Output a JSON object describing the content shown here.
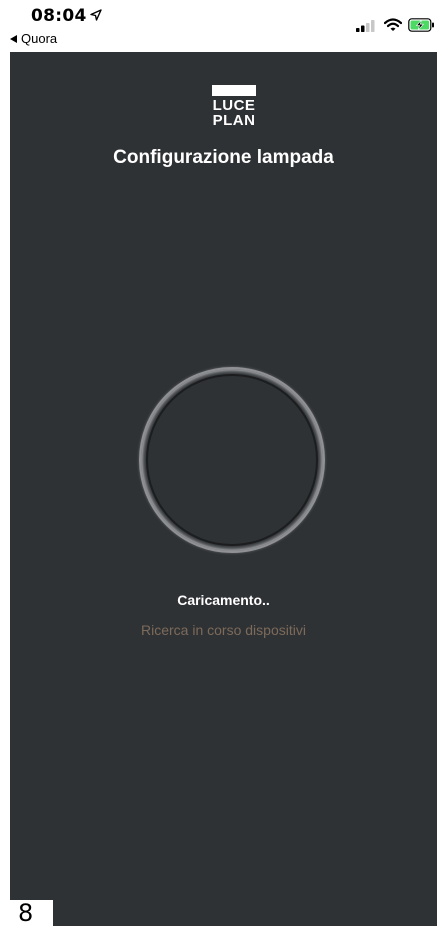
{
  "status_bar": {
    "time": "08:04",
    "back_label": "Quora",
    "icons": [
      "location-arrow-icon",
      "signal-icon",
      "wifi-icon",
      "battery-charging-icon"
    ]
  },
  "app": {
    "logo": {
      "line1": "LUCE",
      "line2": "PLAN"
    },
    "title": "Configurazione lampada",
    "loading_text": "Caricamento..",
    "search_text": "Ricerca in corso dispositivi"
  },
  "page_number": "8",
  "colors": {
    "background": "#2f3235",
    "title": "#ffffff",
    "search_text": "#7c6a5a",
    "ring_outer": "#8f9194",
    "ring_inner": "#1b1d1f"
  }
}
